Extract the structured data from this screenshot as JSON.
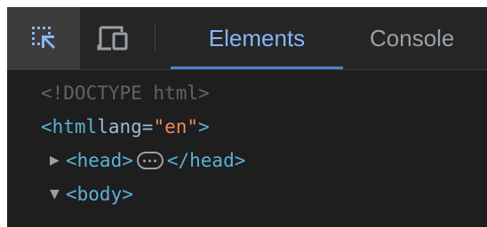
{
  "toolbar": {
    "inspect_icon": "select-element-icon",
    "device_icon": "device-toolbar-icon",
    "tabs": [
      {
        "label": "Elements",
        "active": true
      },
      {
        "label": "Console",
        "active": false
      }
    ]
  },
  "dom_tree": {
    "doctype": "<!DOCTYPE html>",
    "html_open_tag": "<html",
    "html_attr_name": " lang=",
    "html_attr_value": "\"en\"",
    "html_close_bracket": ">",
    "head_open": "<head>",
    "head_close": "</head>",
    "body_open": "<body>"
  },
  "colors": {
    "background": "#1e1e1e",
    "tag": "#5db0d7",
    "attribute_value": "#f28b54",
    "active_tab": "#8ab4f8"
  }
}
